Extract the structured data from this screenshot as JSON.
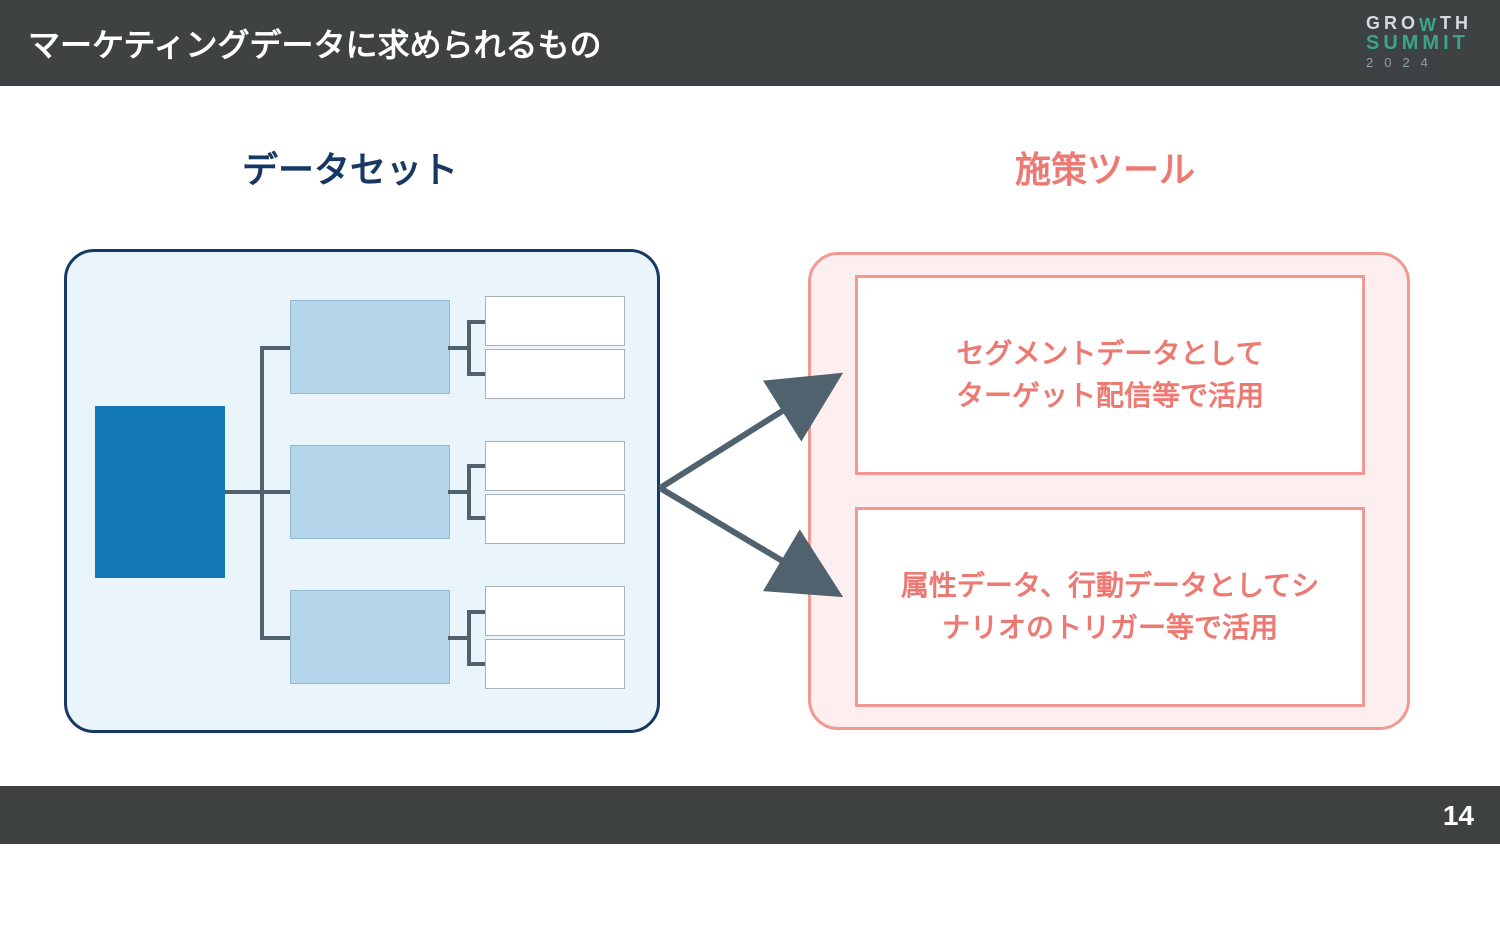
{
  "header": {
    "title": "マーケティングデータに求められるもの"
  },
  "logo": {
    "line1_pre": "GRO",
    "line1_w": "W",
    "line1_post": "TH",
    "line2": "SUMMIT",
    "line3": "2024"
  },
  "columns": {
    "left_title": "データセット",
    "right_title": "施策ツール"
  },
  "tools": {
    "card1": "セグメントデータとして\nターゲット配信等で活用",
    "card2": "属性データ、行動データとしてシ\nナリオのトリガー等で活用"
  },
  "page_number": "14",
  "colors": {
    "header_bg": "#3f4243",
    "dataset_border": "#163862",
    "dataset_fill": "#eaf4fb",
    "tool_border": "#f19891",
    "tool_fill": "#fdefef",
    "tool_text": "#ec7a73",
    "root_block": "#1378b6",
    "mid_block": "#b5d5ea",
    "arrow": "#51626f"
  }
}
